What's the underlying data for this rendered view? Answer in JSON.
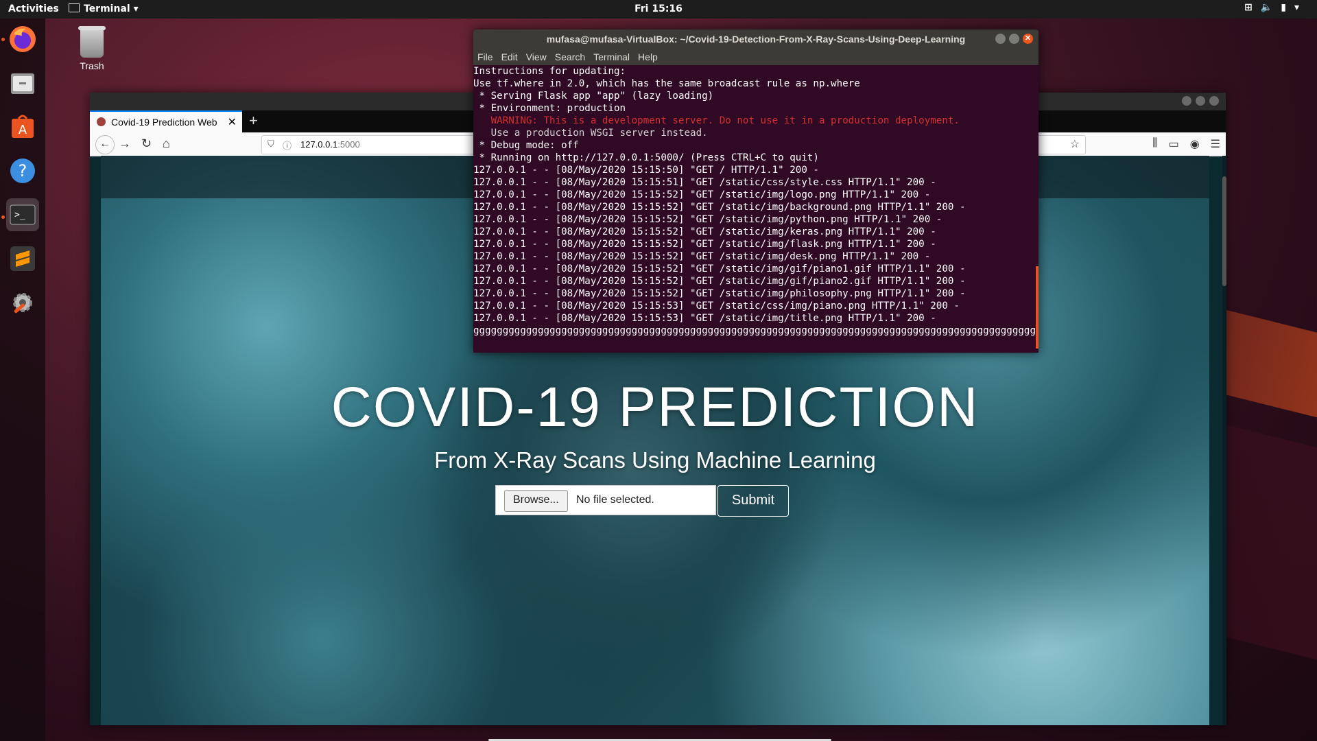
{
  "topbar": {
    "activities": "Activities",
    "app_menu": "Terminal",
    "clock": "Fri 15:16"
  },
  "dock": {
    "items": [
      {
        "name": "firefox-icon"
      },
      {
        "name": "files-icon"
      },
      {
        "name": "software-icon"
      },
      {
        "name": "help-icon"
      },
      {
        "name": "terminal-icon"
      },
      {
        "name": "sublime-text-icon"
      },
      {
        "name": "settings-icon"
      }
    ]
  },
  "desktop": {
    "trash_label": "Trash"
  },
  "browser": {
    "tab_title": "Covid-19 Prediction Web",
    "new_tab": "+",
    "url_host": "127.0.0.1",
    "url_port": ":5000"
  },
  "page": {
    "title": "COVID-19 PREDICTION",
    "subtitle": "From X-Ray Scans Using Machine Learning",
    "browse_label": "Browse...",
    "file_status": "No file selected.",
    "submit_label": "Submit"
  },
  "terminal": {
    "title": "mufasa@mufasa-VirtualBox: ~/Covid-19-Detection-From-X-Ray-Scans-Using-Deep-Learning",
    "menu": [
      "File",
      "Edit",
      "View",
      "Search",
      "Terminal",
      "Help"
    ],
    "lines": [
      "Instructions for updating:",
      "Use tf.where in 2.0, which has the same broadcast rule as np.where",
      " * Serving Flask app \"app\" (lazy loading)",
      " * Environment: production",
      "   WARNING: This is a development server. Do not use it in a production deployment.",
      "   Use a production WSGI server instead.",
      " * Debug mode: off",
      " * Running on http://127.0.0.1:5000/ (Press CTRL+C to quit)",
      "127.0.0.1 - - [08/May/2020 15:15:50] \"GET / HTTP/1.1\" 200 -",
      "127.0.0.1 - - [08/May/2020 15:15:51] \"GET /static/css/style.css HTTP/1.1\" 200 -",
      "127.0.0.1 - - [08/May/2020 15:15:52] \"GET /static/img/logo.png HTTP/1.1\" 200 -",
      "127.0.0.1 - - [08/May/2020 15:15:52] \"GET /static/img/background.png HTTP/1.1\" 200 -",
      "127.0.0.1 - - [08/May/2020 15:15:52] \"GET /static/img/python.png HTTP/1.1\" 200 -",
      "127.0.0.1 - - [08/May/2020 15:15:52] \"GET /static/img/keras.png HTTP/1.1\" 200 -",
      "127.0.0.1 - - [08/May/2020 15:15:52] \"GET /static/img/flask.png HTTP/1.1\" 200 -",
      "127.0.0.1 - - [08/May/2020 15:15:52] \"GET /static/img/desk.png HTTP/1.1\" 200 -",
      "127.0.0.1 - - [08/May/2020 15:15:52] \"GET /static/img/gif/piano1.gif HTTP/1.1\" 200 -",
      "127.0.0.1 - - [08/May/2020 15:15:52] \"GET /static/img/gif/piano2.gif HTTP/1.1\" 200 -",
      "127.0.0.1 - - [08/May/2020 15:15:52] \"GET /static/img/philosophy.png HTTP/1.1\" 200 -",
      "127.0.0.1 - - [08/May/2020 15:15:53] \"GET /static/css/img/piano.png HTTP/1.1\" 200 -",
      "127.0.0.1 - - [08/May/2020 15:15:53] \"GET /static/img/title.png HTTP/1.1\" 200 -",
      "gggggggggggggggggggggggggggggggggggggggggggggggggggggggggggggggggggggggggggggggggggggggggggggggggggggggggg"
    ],
    "warning_line_index": 4,
    "dim_line_index": 5
  },
  "colors": {
    "terminal_bg": "#300a24",
    "accent": "#e95420",
    "firefox_tab_accent": "#0a84ff",
    "warning": "#d43030"
  }
}
